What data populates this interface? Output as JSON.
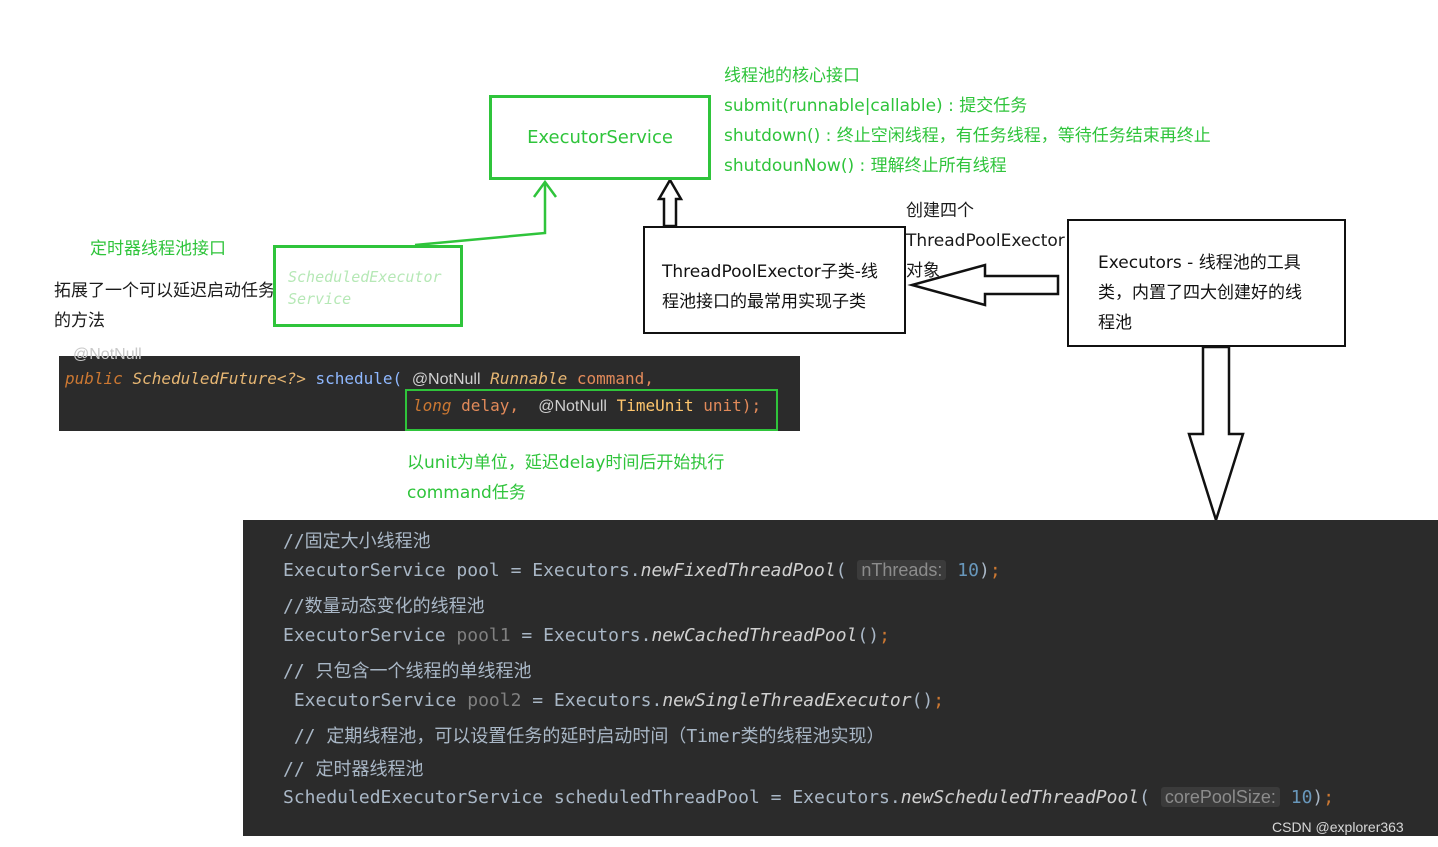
{
  "executor_service": {
    "label": "ExecutorService",
    "notes": [
      "线程池的核心接口",
      "submit(runnable|callable) : 提交任务",
      "shutdown() : 终止空闲线程，有任务线程，等待任务结束再终止",
      "shutdounNow() : 理解终止所有线程"
    ]
  },
  "scheduled_executor_service": {
    "label_line1": "ScheduledExecutor",
    "label_line2": "Service",
    "title": "定时器线程池接口",
    "desc_line1": "拓展了一个可以延迟启动任务",
    "desc_line2": "的方法"
  },
  "thread_pool_executor": {
    "line1": "ThreadPoolExector子类-线",
    "line2": "程池接口的最常用实现子类"
  },
  "executors": {
    "line1": "Executors - 线程池的工具",
    "line2": "类，内置了四大创建好的线",
    "line3": "程池"
  },
  "create_note": {
    "line1": "创建四个",
    "line2": "ThreadPoolExector",
    "line3": "对象"
  },
  "schedule_signature": {
    "cutoff": "@NotNull",
    "public": "public",
    "return_type": "ScheduledFuture<?>",
    "method": "schedule(",
    "ann1": "@NotNull",
    "type1": "Runnable",
    "param1": "command,",
    "long": "long",
    "param2": "delay,",
    "ann2": "@NotNull",
    "type2": "TimeUnit",
    "param3": "unit);"
  },
  "delay_note": {
    "line1": "以unit为单位，延迟delay时间后开始执行",
    "line2": "command任务"
  },
  "code": {
    "c1": "//固定大小线程池",
    "l1_a": "ExecutorService pool = Executors.",
    "l1_method": "newFixedThreadPool",
    "l1_open": "(",
    "l1_hint": "nThreads:",
    "l1_num": "10",
    "l1_close": ")",
    "l1_semi": ";",
    "c2": "//数量动态变化的线程池",
    "l2_a": "ExecutorService ",
    "l2_var": "pool1",
    "l2_b": " = Executors.",
    "l2_method": "newCachedThreadPool",
    "l2_paren": "()",
    "l2_semi": ";",
    "c3": "// 只包含一个线程的单线程池",
    "l3_a": " ExecutorService ",
    "l3_var": "pool2",
    "l3_b": " = Executors.",
    "l3_method": "newSingleThreadExecutor",
    "l3_paren": "()",
    "l3_semi": ";",
    "c4": " // 定期线程池，可以设置任务的延时启动时间（Timer类的线程池实现）",
    "c5": "// 定时器线程池",
    "l5_a": "ScheduledExecutorService scheduledThreadPool = Executors.",
    "l5_method": "newScheduledThreadPool",
    "l5_open": "(",
    "l5_hint": "corePoolSize:",
    "l5_num": "10",
    "l5_close": ")",
    "l5_semi": ";"
  },
  "watermark": "CSDN @explorer363",
  "colors": {
    "accent_green": "#2fc43b",
    "code_background": "#2b2b2b",
    "keyword": "#cc7832",
    "comment": "#808080",
    "number": "#6897bb"
  }
}
